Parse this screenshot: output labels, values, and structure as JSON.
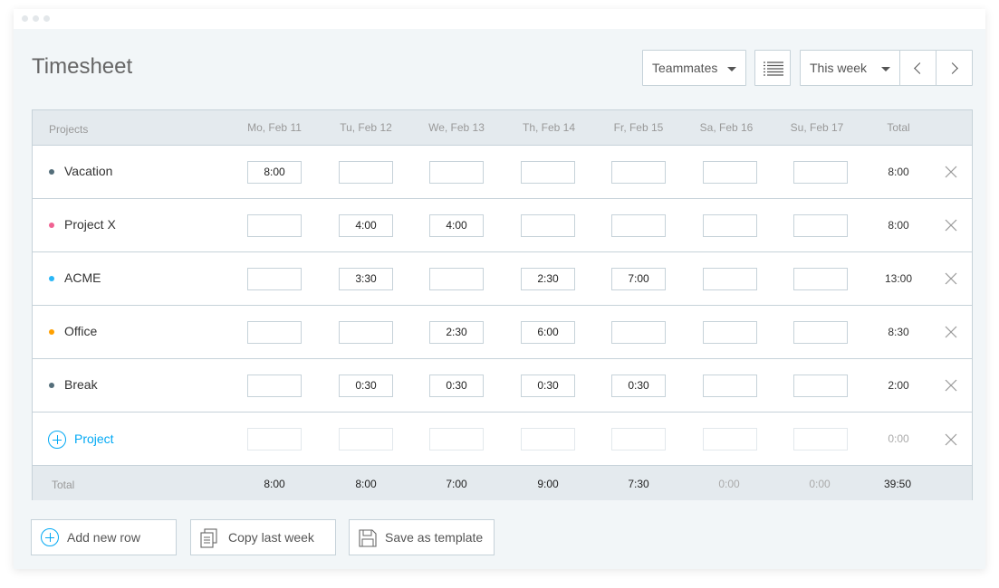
{
  "header": {
    "title": "Timesheet",
    "teammates_label": "Teammates",
    "week_label": "This week"
  },
  "table": {
    "projects_header": "Projects",
    "total_header": "Total",
    "days": [
      "Mo, Feb 11",
      "Tu, Feb 12",
      "We, Feb 13",
      "Th, Feb 14",
      "Fr, Feb 15",
      "Sa, Feb 16",
      "Su, Feb 17"
    ],
    "rows": [
      {
        "name": "Vacation",
        "color": "#546e7a",
        "values": [
          "8:00",
          "",
          "",
          "",
          "",
          "",
          ""
        ],
        "total": "8:00"
      },
      {
        "name": "Project X",
        "color": "#f06292",
        "values": [
          "",
          "4:00",
          "4:00",
          "",
          "",
          "",
          ""
        ],
        "total": "8:00"
      },
      {
        "name": "ACME",
        "color": "#29b6f6",
        "values": [
          "",
          "3:30",
          "",
          "2:30",
          "7:00",
          "",
          ""
        ],
        "total": "13:00"
      },
      {
        "name": "Office",
        "color": "#ffa000",
        "values": [
          "",
          "",
          "2:30",
          "6:00",
          "",
          "",
          ""
        ],
        "total": "8:30"
      },
      {
        "name": "Break",
        "color": "#546e7a",
        "values": [
          "",
          "0:30",
          "0:30",
          "0:30",
          "0:30",
          "",
          ""
        ],
        "total": "2:00"
      }
    ],
    "new_row": {
      "label": "Project",
      "total": "0:00"
    },
    "footer": {
      "label": "Total",
      "values": [
        "8:00",
        "8:00",
        "7:00",
        "9:00",
        "7:30",
        "0:00",
        "0:00"
      ],
      "grand_total": "39:50"
    }
  },
  "actions": {
    "add_row": "Add new row",
    "copy_week": "Copy last week",
    "save_template": "Save as template"
  },
  "colors": {
    "accent": "#03a9f4",
    "border": "#c6d2d9",
    "header_bg": "#e4eaee",
    "page_bg": "#f2f6f8"
  }
}
